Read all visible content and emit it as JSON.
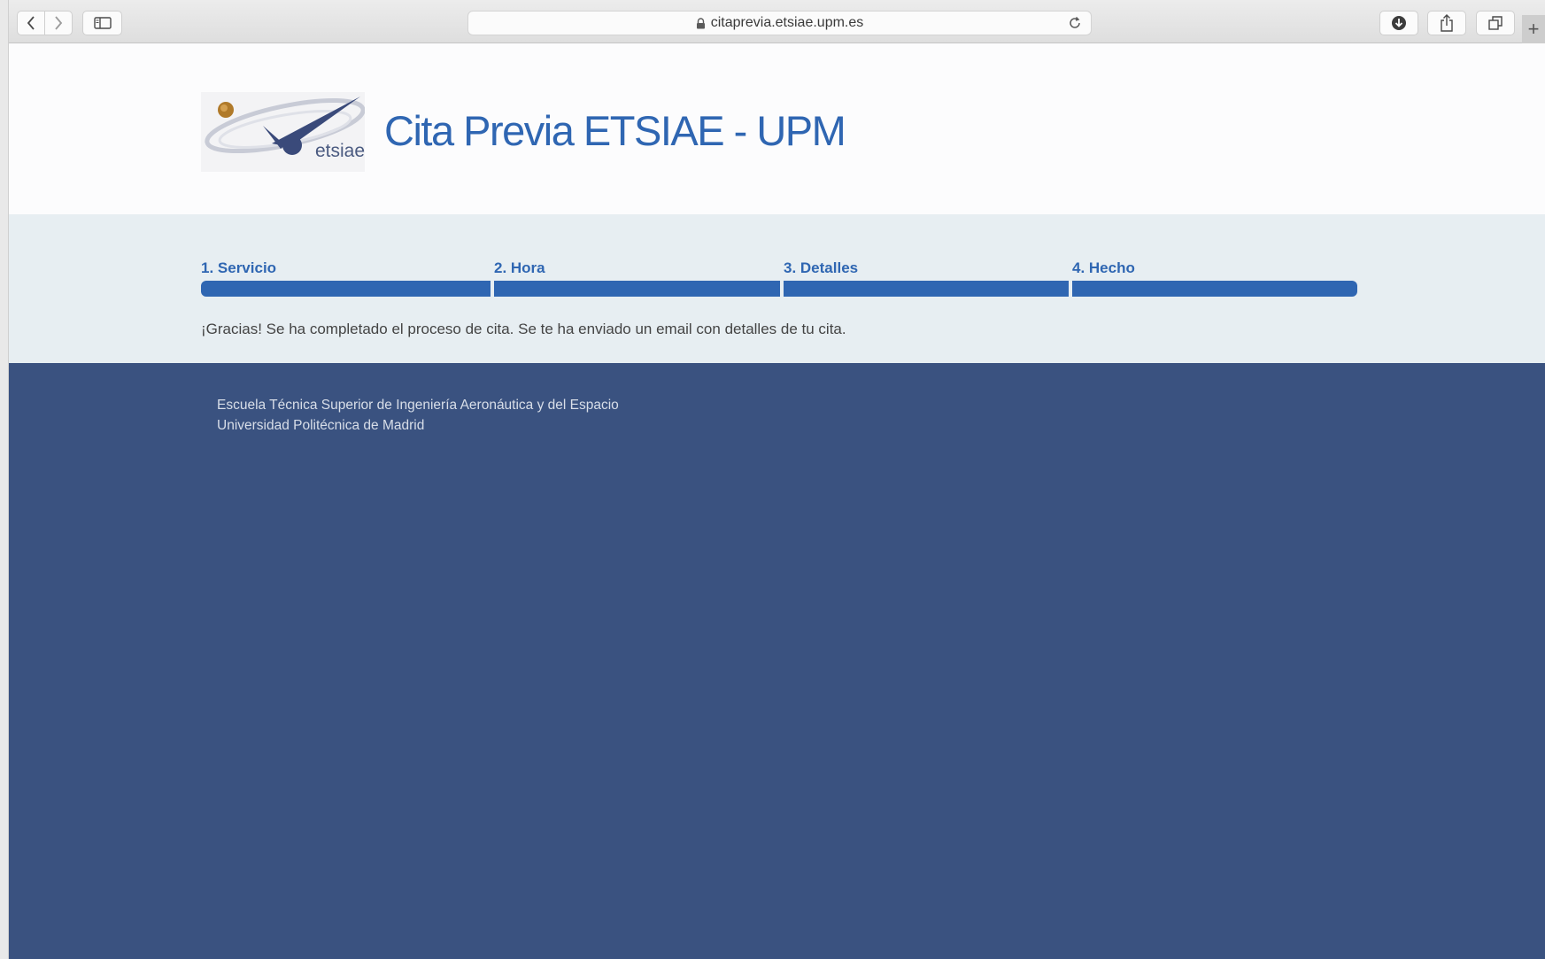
{
  "browser": {
    "url": "citaprevia.etsiae.upm.es",
    "icons": [
      "back-icon",
      "forward-icon",
      "sidebar-icon",
      "lock-icon",
      "reload-icon",
      "download-icon",
      "share-icon",
      "tabs-icon",
      "new-tab-icon"
    ]
  },
  "header": {
    "logo_text": "etsiae",
    "title": "Cita Previa ETSIAE - UPM"
  },
  "steps": [
    {
      "label": "1. Servicio",
      "complete": true
    },
    {
      "label": "2. Hora",
      "complete": true
    },
    {
      "label": "3. Detalles",
      "complete": true
    },
    {
      "label": "4. Hecho",
      "complete": true
    }
  ],
  "message": "¡Gracias! Se ha completado el proceso de cita. Se te ha enviado un email con detalles de tu cita.",
  "footer": {
    "line1": "Escuela Técnica Superior de Ingeniería Aeronáutica y del Espacio",
    "line2": "Universidad Politécnica de Madrid"
  },
  "colors": {
    "accent": "#2f66b2",
    "footer_bg": "#3a5280",
    "steps_bg": "#e7eef2"
  }
}
